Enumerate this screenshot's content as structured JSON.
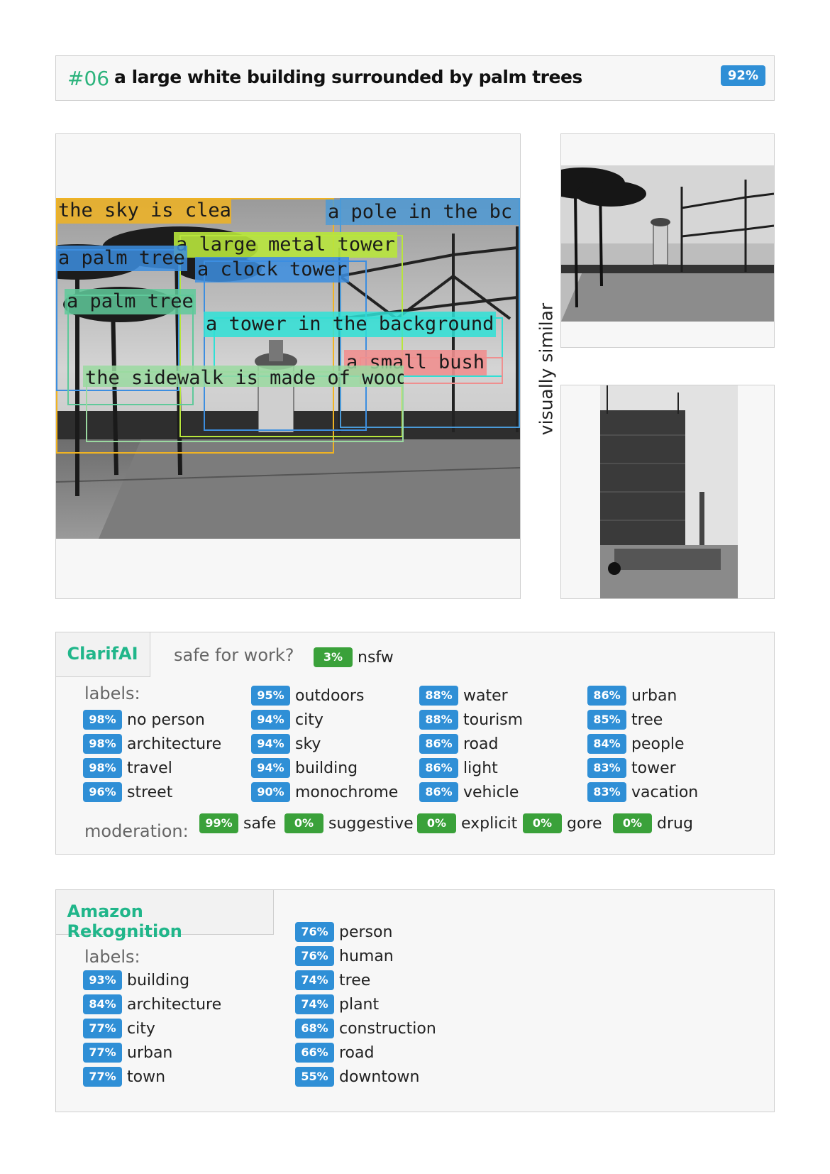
{
  "header": {
    "number": "#06",
    "caption": "a large white building surrounded by palm trees",
    "confidence": "92%"
  },
  "main_image": {
    "alt": "black and white photo of a plaza with palm trees, a tower and gas holder frames",
    "regions": [
      {
        "label": "the sky is clear",
        "color": "#f0b322"
      },
      {
        "label": "a pole in the bc",
        "color": "#4a9ad8"
      },
      {
        "label": "a large metal tower",
        "color": "#b8e63c"
      },
      {
        "label": "a palm tree",
        "color": "#3c8ee0"
      },
      {
        "label": "a clock tower",
        "color": "#3c8ee0"
      },
      {
        "label": "a palm tree",
        "color": "#5fc99a"
      },
      {
        "label": "a tower in the background",
        "color": "#2fe0d6"
      },
      {
        "label": "a small bush",
        "color": "#ef8f8f"
      },
      {
        "label": "the sidewalk is made of wood",
        "color": "#9ad9a0"
      }
    ]
  },
  "similar": {
    "label": "visually similar"
  },
  "clarifai": {
    "name": "ClarifAI",
    "sfw_question": "safe for work?",
    "nsfw": {
      "value": "3%",
      "label": "nsfw"
    },
    "labels_heading": "labels:",
    "labels": [
      [
        {
          "v": "98%",
          "t": "no person"
        },
        {
          "v": "98%",
          "t": "architecture"
        },
        {
          "v": "98%",
          "t": "travel"
        },
        {
          "v": "96%",
          "t": "street"
        }
      ],
      [
        {
          "v": "95%",
          "t": "outdoors"
        },
        {
          "v": "94%",
          "t": "city"
        },
        {
          "v": "94%",
          "t": "sky"
        },
        {
          "v": "94%",
          "t": "building"
        },
        {
          "v": "90%",
          "t": "monochrome"
        }
      ],
      [
        {
          "v": "88%",
          "t": "water"
        },
        {
          "v": "88%",
          "t": "tourism"
        },
        {
          "v": "86%",
          "t": "road"
        },
        {
          "v": "86%",
          "t": "light"
        },
        {
          "v": "86%",
          "t": "vehicle"
        }
      ],
      [
        {
          "v": "86%",
          "t": "urban"
        },
        {
          "v": "85%",
          "t": "tree"
        },
        {
          "v": "84%",
          "t": "people"
        },
        {
          "v": "83%",
          "t": "tower"
        },
        {
          "v": "83%",
          "t": "vacation"
        }
      ]
    ],
    "moderation_heading": "moderation:",
    "moderation": [
      {
        "v": "99%",
        "t": "safe"
      },
      {
        "v": "0%",
        "t": "suggestive"
      },
      {
        "v": "0%",
        "t": "explicit"
      },
      {
        "v": "0%",
        "t": "gore"
      },
      {
        "v": "0%",
        "t": "drug"
      }
    ]
  },
  "amazon": {
    "name": "Amazon Rekognition",
    "labels_heading": "labels:",
    "labels": [
      [
        {
          "v": "93%",
          "t": "building"
        },
        {
          "v": "84%",
          "t": "architecture"
        },
        {
          "v": "77%",
          "t": "city"
        },
        {
          "v": "77%",
          "t": "urban"
        },
        {
          "v": "77%",
          "t": "town"
        }
      ],
      [
        {
          "v": "76%",
          "t": "person"
        },
        {
          "v": "76%",
          "t": "human"
        },
        {
          "v": "74%",
          "t": "tree"
        },
        {
          "v": "74%",
          "t": "plant"
        },
        {
          "v": "68%",
          "t": "construction"
        },
        {
          "v": "66%",
          "t": "road"
        },
        {
          "v": "55%",
          "t": "downtown"
        }
      ]
    ]
  }
}
